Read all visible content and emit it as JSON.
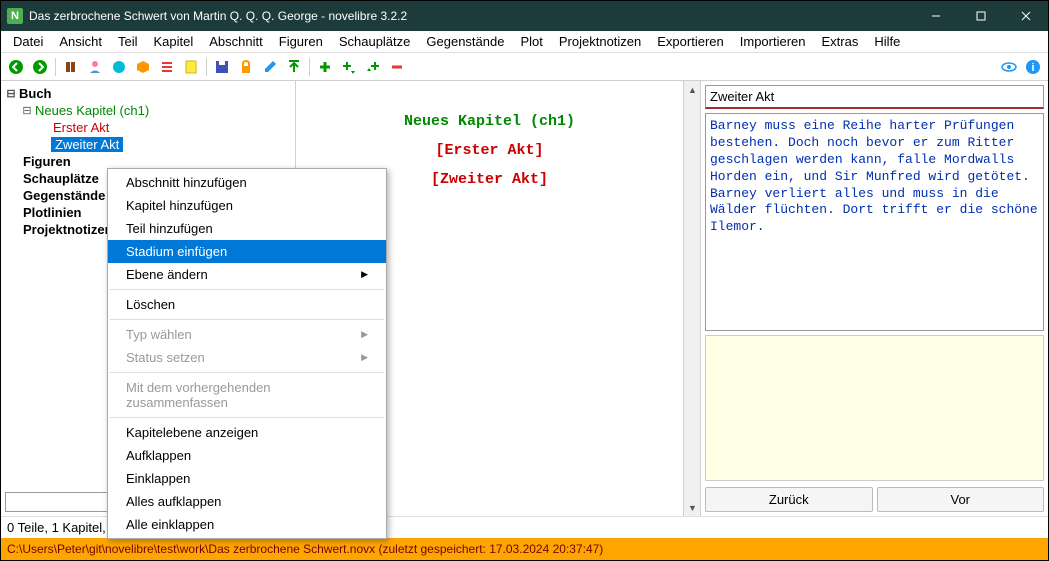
{
  "window": {
    "title": "Das zerbrochene Schwert von Martin Q. Q. Q. George - novelibre 3.2.2",
    "icon_letter": "N"
  },
  "menubar": [
    "Datei",
    "Ansicht",
    "Teil",
    "Kapitel",
    "Abschnitt",
    "Figuren",
    "Schauplätze",
    "Gegenstände",
    "Plot",
    "Projektnotizen",
    "Exportieren",
    "Importieren",
    "Extras",
    "Hilfe"
  ],
  "tree": {
    "root": "Buch",
    "chapter": "Neues Kapitel (ch1)",
    "act1": "Erster Akt",
    "act2": "Zweiter Akt",
    "figures": "Figuren",
    "places": "Schauplätze",
    "items": "Gegenstände",
    "plotlines": "Plotlinien",
    "notes": "Projektnotizen"
  },
  "context_menu": {
    "add_section": "Abschnitt hinzufügen",
    "add_chapter": "Kapitel hinzufügen",
    "add_part": "Teil hinzufügen",
    "insert_stage": "Stadium einfügen",
    "change_level": "Ebene ändern",
    "delete": "Löschen",
    "choose_type": "Typ wählen",
    "set_status": "Status setzen",
    "merge_prev": "Mit dem vorhergehenden zusammenfassen",
    "show_chapter_level": "Kapitelebene anzeigen",
    "expand": "Aufklappen",
    "collapse": "Einklappen",
    "expand_all": "Alles aufklappen",
    "collapse_all": "Alle einklappen"
  },
  "document": {
    "line1": "Neues Kapitel (ch1)",
    "line2": "[Erster Akt]",
    "line3": "[Zweiter Akt]"
  },
  "details": {
    "title": "Zweiter Akt",
    "text": "Barney muss eine Reihe harter Prüfungen bestehen. Doch noch bevor er zum Ritter geschlagen werden kann, falle Mordwalls Horden ein, und Sir Munfred wird getötet. Barney verliert alles und muss in die Wälder flüchten. Dort trifft er die schöne Ilemor."
  },
  "nav": {
    "back": "Zurück",
    "forward": "Vor"
  },
  "statusbar": "0 Teile, 1 Kapitel, 0 Abschnitte, 0 Wörter",
  "pathbar": "C:\\Users\\Peter\\git\\novelibre\\test\\work\\Das zerbrochene Schwert.novx (zuletzt gespeichert: 17.03.2024 20:37:47)"
}
